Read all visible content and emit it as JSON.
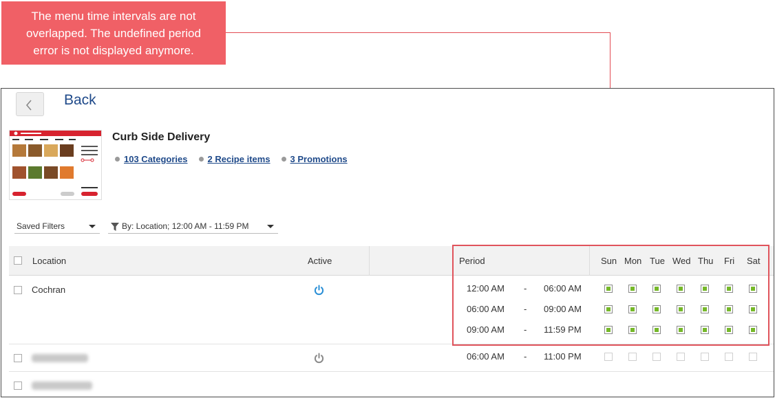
{
  "callout": {
    "line1": "The menu time intervals are not",
    "line2": "overlapped. The undefined period",
    "line3": "error is not displayed anymore."
  },
  "nav": {
    "back_label": "Back"
  },
  "menu": {
    "title": "Curb Side Delivery",
    "categories_link": "103 Categories",
    "recipe_link": "2 Recipe items",
    "promotions_link": "3 Promotions"
  },
  "filters": {
    "saved_filters": "Saved Filters",
    "by_filter": "By: Location; 12:00 AM - 11:59 PM"
  },
  "table": {
    "headers": {
      "location": "Location",
      "active": "Active",
      "period": "Period",
      "days": [
        "Sun",
        "Mon",
        "Tue",
        "Wed",
        "Thu",
        "Fri",
        "Sat"
      ]
    },
    "rows": [
      {
        "location": "Cochran",
        "active": true,
        "periods": [
          {
            "start": "12:00 AM",
            "sep": "-",
            "end": "06:00 AM",
            "days": [
              true,
              true,
              true,
              true,
              true,
              true,
              true
            ]
          },
          {
            "start": "06:00 AM",
            "sep": "-",
            "end": "09:00 AM",
            "days": [
              true,
              true,
              true,
              true,
              true,
              true,
              true
            ]
          },
          {
            "start": "09:00 AM",
            "sep": "-",
            "end": "11:59 PM",
            "days": [
              true,
              true,
              true,
              true,
              true,
              true,
              true
            ]
          }
        ]
      },
      {
        "location": "",
        "active": false,
        "periods": [
          {
            "start": "06:00 AM",
            "sep": "-",
            "end": "11:00 PM",
            "days": [
              false,
              false,
              false,
              false,
              false,
              false,
              false
            ]
          }
        ]
      },
      {
        "location": "",
        "active": false,
        "periods": []
      }
    ]
  },
  "colors": {
    "callout_bg": "#f06066",
    "link": "#1f4a8a",
    "active_icon": "#2a8fd6",
    "inactive_icon": "#8a8a8a",
    "day_checked": "#76b82a",
    "highlight": "#e0535b"
  }
}
